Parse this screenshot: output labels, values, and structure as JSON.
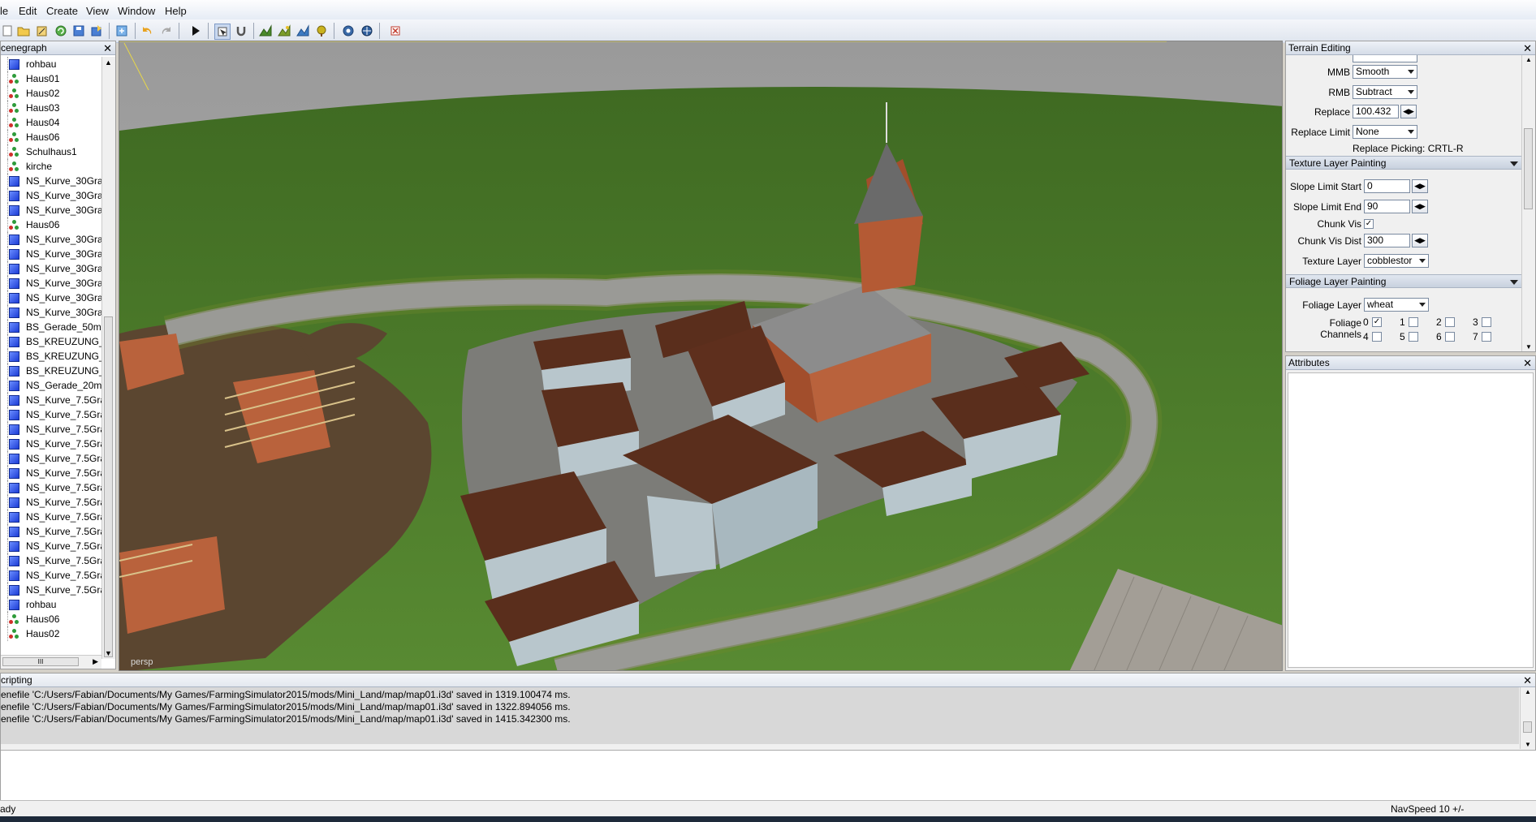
{
  "menu": [
    "le",
    "Edit",
    "Create",
    "View",
    "Window",
    "Help"
  ],
  "scenegraph": {
    "title": "cenegraph",
    "items": [
      {
        "label": "rohbau",
        "icon": "mesh"
      },
      {
        "label": "Haus01",
        "icon": "transform"
      },
      {
        "label": "Haus02",
        "icon": "transform"
      },
      {
        "label": "Haus03",
        "icon": "transform"
      },
      {
        "label": "Haus04",
        "icon": "transform"
      },
      {
        "label": "Haus06",
        "icon": "transform"
      },
      {
        "label": "Schulhaus1",
        "icon": "transform"
      },
      {
        "label": "kirche",
        "icon": "transform"
      },
      {
        "label": "NS_Kurve_30Grad",
        "icon": "mesh"
      },
      {
        "label": "NS_Kurve_30Grad",
        "icon": "mesh"
      },
      {
        "label": "NS_Kurve_30Grad",
        "icon": "mesh"
      },
      {
        "label": "Haus06",
        "icon": "transform"
      },
      {
        "label": "NS_Kurve_30Grad",
        "icon": "mesh"
      },
      {
        "label": "NS_Kurve_30Grad",
        "icon": "mesh"
      },
      {
        "label": "NS_Kurve_30Grad",
        "icon": "mesh"
      },
      {
        "label": "NS_Kurve_30Grad",
        "icon": "mesh"
      },
      {
        "label": "NS_Kurve_30Grad",
        "icon": "mesh"
      },
      {
        "label": "NS_Kurve_30Grad",
        "icon": "mesh"
      },
      {
        "label": "BS_Gerade_50m",
        "icon": "mesh"
      },
      {
        "label": "BS_KREUZUNG_M",
        "icon": "mesh"
      },
      {
        "label": "BS_KREUZUNG_M",
        "icon": "mesh"
      },
      {
        "label": "BS_KREUZUNG_M",
        "icon": "mesh"
      },
      {
        "label": "NS_Gerade_20m",
        "icon": "mesh"
      },
      {
        "label": "NS_Kurve_7.5Grad",
        "icon": "mesh"
      },
      {
        "label": "NS_Kurve_7.5Grad",
        "icon": "mesh"
      },
      {
        "label": "NS_Kurve_7.5Grad",
        "icon": "mesh"
      },
      {
        "label": "NS_Kurve_7.5Grad",
        "icon": "mesh"
      },
      {
        "label": "NS_Kurve_7.5Grad",
        "icon": "mesh"
      },
      {
        "label": "NS_Kurve_7.5Grad",
        "icon": "mesh"
      },
      {
        "label": "NS_Kurve_7.5Grad",
        "icon": "mesh"
      },
      {
        "label": "NS_Kurve_7.5Grad",
        "icon": "mesh"
      },
      {
        "label": "NS_Kurve_7.5Grad",
        "icon": "mesh"
      },
      {
        "label": "NS_Kurve_7.5Grad",
        "icon": "mesh"
      },
      {
        "label": "NS_Kurve_7.5Grad",
        "icon": "mesh"
      },
      {
        "label": "NS_Kurve_7.5Grad",
        "icon": "mesh"
      },
      {
        "label": "NS_Kurve_7.5Grad",
        "icon": "mesh"
      },
      {
        "label": "NS_Kurve_7.5Grad",
        "icon": "mesh"
      },
      {
        "label": "rohbau",
        "icon": "mesh"
      },
      {
        "label": "Haus06",
        "icon": "transform"
      },
      {
        "label": "Haus02",
        "icon": "transform"
      }
    ],
    "hscroll_grip": "III"
  },
  "viewport": {
    "camera_label": "persp"
  },
  "terrain": {
    "title": "Terrain Editing",
    "mmb_label": "MMB",
    "mmb_value": "Smooth",
    "rmb_label": "RMB",
    "rmb_value": "Subtract",
    "replace_label": "Replace",
    "replace_value": "100.432",
    "replace_limit_label": "Replace Limit",
    "replace_limit_value": "None",
    "replace_picking": "Replace Picking: CRTL-R",
    "texture_section": "Texture Layer Painting",
    "slope_start_label": "Slope Limit Start",
    "slope_start_value": "0",
    "slope_end_label": "Slope Limit End",
    "slope_end_value": "90",
    "chunk_vis_label": "Chunk Vis",
    "chunk_vis_dist_label": "Chunk Vis Dist",
    "chunk_vis_dist_value": "300",
    "texture_layer_label": "Texture Layer",
    "texture_layer_value": "cobblestor",
    "foliage_section": "Foliage Layer Painting",
    "foliage_layer_label": "Foliage Layer",
    "foliage_layer_value": "wheat",
    "foliage_channels_label": "Foliage Channels",
    "channels": [
      "0",
      "1",
      "2",
      "3",
      "4",
      "5",
      "6",
      "7"
    ]
  },
  "attributes": {
    "title": "Attributes"
  },
  "scripting": {
    "title": "cripting",
    "log": [
      "enefile 'C:/Users/Fabian/Documents/My Games/FarmingSimulator2015/mods/Mini_Land/map/map01.i3d' saved in 1319.100474 ms.",
      "enefile 'C:/Users/Fabian/Documents/My Games/FarmingSimulator2015/mods/Mini_Land/map/map01.i3d' saved in 1322.894056 ms.",
      "enefile 'C:/Users/Fabian/Documents/My Games/FarmingSimulator2015/mods/Mini_Land/map/map01.i3d' saved in 1415.342300 ms."
    ]
  },
  "status": {
    "left": "ady",
    "right": "NavSpeed 10 +/-"
  },
  "colors": {
    "grass": "#4f7a2a",
    "road": "#9a9a96",
    "roof": "#5a2e1c",
    "wall": "#b8c6cc",
    "brick": "#b9623c",
    "sky": "#a3a3a3"
  }
}
